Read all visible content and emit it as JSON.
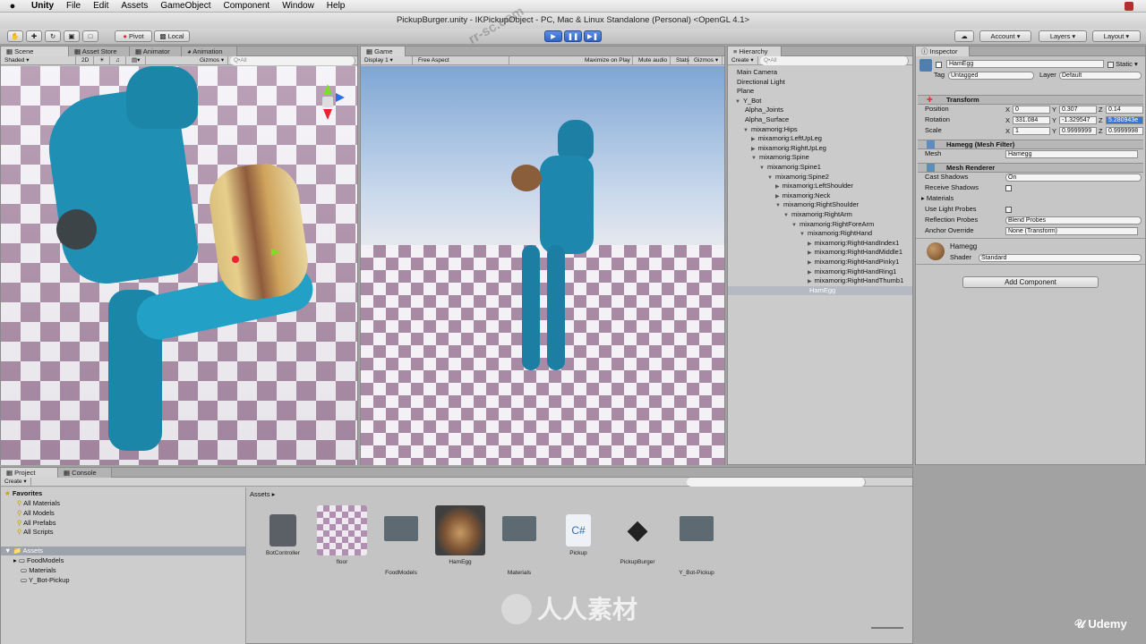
{
  "menubar": {
    "app": "Unity",
    "items": [
      "File",
      "Edit",
      "Assets",
      "GameObject",
      "Component",
      "Window",
      "Help"
    ]
  },
  "title": "PickupBurger.unity - IKPickupObject - PC, Mac & Linux Standalone (Personal) <OpenGL 4.1>",
  "toolbar": {
    "pivot": "Pivot",
    "local": "Local",
    "account": "Account",
    "layers": "Layers",
    "layout": "Layout"
  },
  "scene": {
    "tabs": [
      "Scene",
      "Asset Store",
      "Animator",
      "Animation"
    ],
    "shading": "Shaded",
    "mode2d": "2D",
    "gizmos": "Gizmos",
    "search": "Q•All"
  },
  "game": {
    "tab": "Game",
    "display": "Display 1",
    "aspect": "Free Aspect",
    "maximize": "Maximize on Play",
    "mute": "Mute audio",
    "stats": "Stats",
    "gizmos": "Gizmos"
  },
  "hierarchy": {
    "tab": "Hierarchy",
    "create": "Create",
    "search": "Q•All",
    "rows": [
      {
        "label": "Main Camera",
        "indent": 0,
        "arrow": ""
      },
      {
        "label": "Directional Light",
        "indent": 0,
        "arrow": ""
      },
      {
        "label": "Plane",
        "indent": 0,
        "arrow": ""
      },
      {
        "label": "Y_Bot",
        "indent": 0,
        "arrow": "▼"
      },
      {
        "label": "Alpha_Joints",
        "indent": 1,
        "arrow": ""
      },
      {
        "label": "Alpha_Surface",
        "indent": 1,
        "arrow": ""
      },
      {
        "label": "mixamorig:Hips",
        "indent": 1,
        "arrow": "▼"
      },
      {
        "label": "mixamorig:LeftUpLeg",
        "indent": 2,
        "arrow": "▶"
      },
      {
        "label": "mixamorig:RightUpLeg",
        "indent": 2,
        "arrow": "▶"
      },
      {
        "label": "mixamorig:Spine",
        "indent": 2,
        "arrow": "▼"
      },
      {
        "label": "mixamorig:Spine1",
        "indent": 3,
        "arrow": "▼"
      },
      {
        "label": "mixamorig:Spine2",
        "indent": 4,
        "arrow": "▼"
      },
      {
        "label": "mixamorig:LeftShoulder",
        "indent": 5,
        "arrow": "▶"
      },
      {
        "label": "mixamorig:Neck",
        "indent": 5,
        "arrow": "▶"
      },
      {
        "label": "mixamorig:RightShoulder",
        "indent": 5,
        "arrow": "▼"
      },
      {
        "label": "mixamorig:RightArm",
        "indent": 6,
        "arrow": "▼"
      },
      {
        "label": "mixamorig:RightForeArm",
        "indent": 7,
        "arrow": "▼"
      },
      {
        "label": "mixamorig:RightHand",
        "indent": 8,
        "arrow": "▼"
      },
      {
        "label": "mixamorig:RightHandIndex1",
        "indent": 9,
        "arrow": "▶"
      },
      {
        "label": "mixamorig:RightHandMiddle1",
        "indent": 9,
        "arrow": "▶"
      },
      {
        "label": "mixamorig:RightHandPinky1",
        "indent": 9,
        "arrow": "▶"
      },
      {
        "label": "mixamorig:RightHandRing1",
        "indent": 9,
        "arrow": "▶"
      },
      {
        "label": "mixamorig:RightHandThumb1",
        "indent": 9,
        "arrow": "▶"
      },
      {
        "label": "HamEgg",
        "indent": 9,
        "arrow": "",
        "selected": true
      }
    ]
  },
  "inspector": {
    "tab": "Inspector",
    "name": "HamEgg",
    "static": "Static",
    "tag_label": "Tag",
    "tag": "Untagged",
    "layer_label": "Layer",
    "layer": "Default",
    "transform": {
      "title": "Transform",
      "position": "Position",
      "rotation": "Rotation",
      "scale": "Scale",
      "pos": [
        "0",
        "0.307",
        "0.14"
      ],
      "rot": [
        "331.084",
        "-1.329547",
        "5.280943e"
      ],
      "scl": [
        "1",
        "0.9999999",
        "0.9999998"
      ]
    },
    "meshfilter": {
      "title": "Hamegg (Mesh Filter)",
      "mesh_label": "Mesh",
      "mesh": "Hamegg"
    },
    "renderer": {
      "title": "Mesh Renderer",
      "cast_label": "Cast Shadows",
      "cast": "On",
      "receive_label": "Receive Shadows",
      "materials": "Materials",
      "lightprobes": "Use Light Probes",
      "reflection_label": "Reflection Probes",
      "reflection": "Blend Probes",
      "anchor_label": "Anchor Override",
      "anchor": "None (Transform)"
    },
    "material": {
      "name": "Hamegg",
      "shader_label": "Shader",
      "shader": "Standard"
    },
    "add_component": "Add Component"
  },
  "project": {
    "tabs": [
      "Project",
      "Console"
    ],
    "create": "Create",
    "favorites": "Favorites",
    "fav_items": [
      "All Materials",
      "All Models",
      "All Prefabs",
      "All Scripts"
    ],
    "assets_label": "Assets",
    "tree": [
      "FoodModels",
      "Materials",
      "Y_Bot-Pickup"
    ],
    "breadcrumb": "Assets ▸",
    "assets": [
      "BotController",
      "floor",
      "FoodModels",
      "HamEgg",
      "Materials",
      "Pickup",
      "PickupBurger",
      "Y_Bot-Pickup"
    ]
  },
  "watermark": {
    "brand": "人人素材",
    "udemy": "Udemy",
    "site": "rr-sc.com"
  }
}
